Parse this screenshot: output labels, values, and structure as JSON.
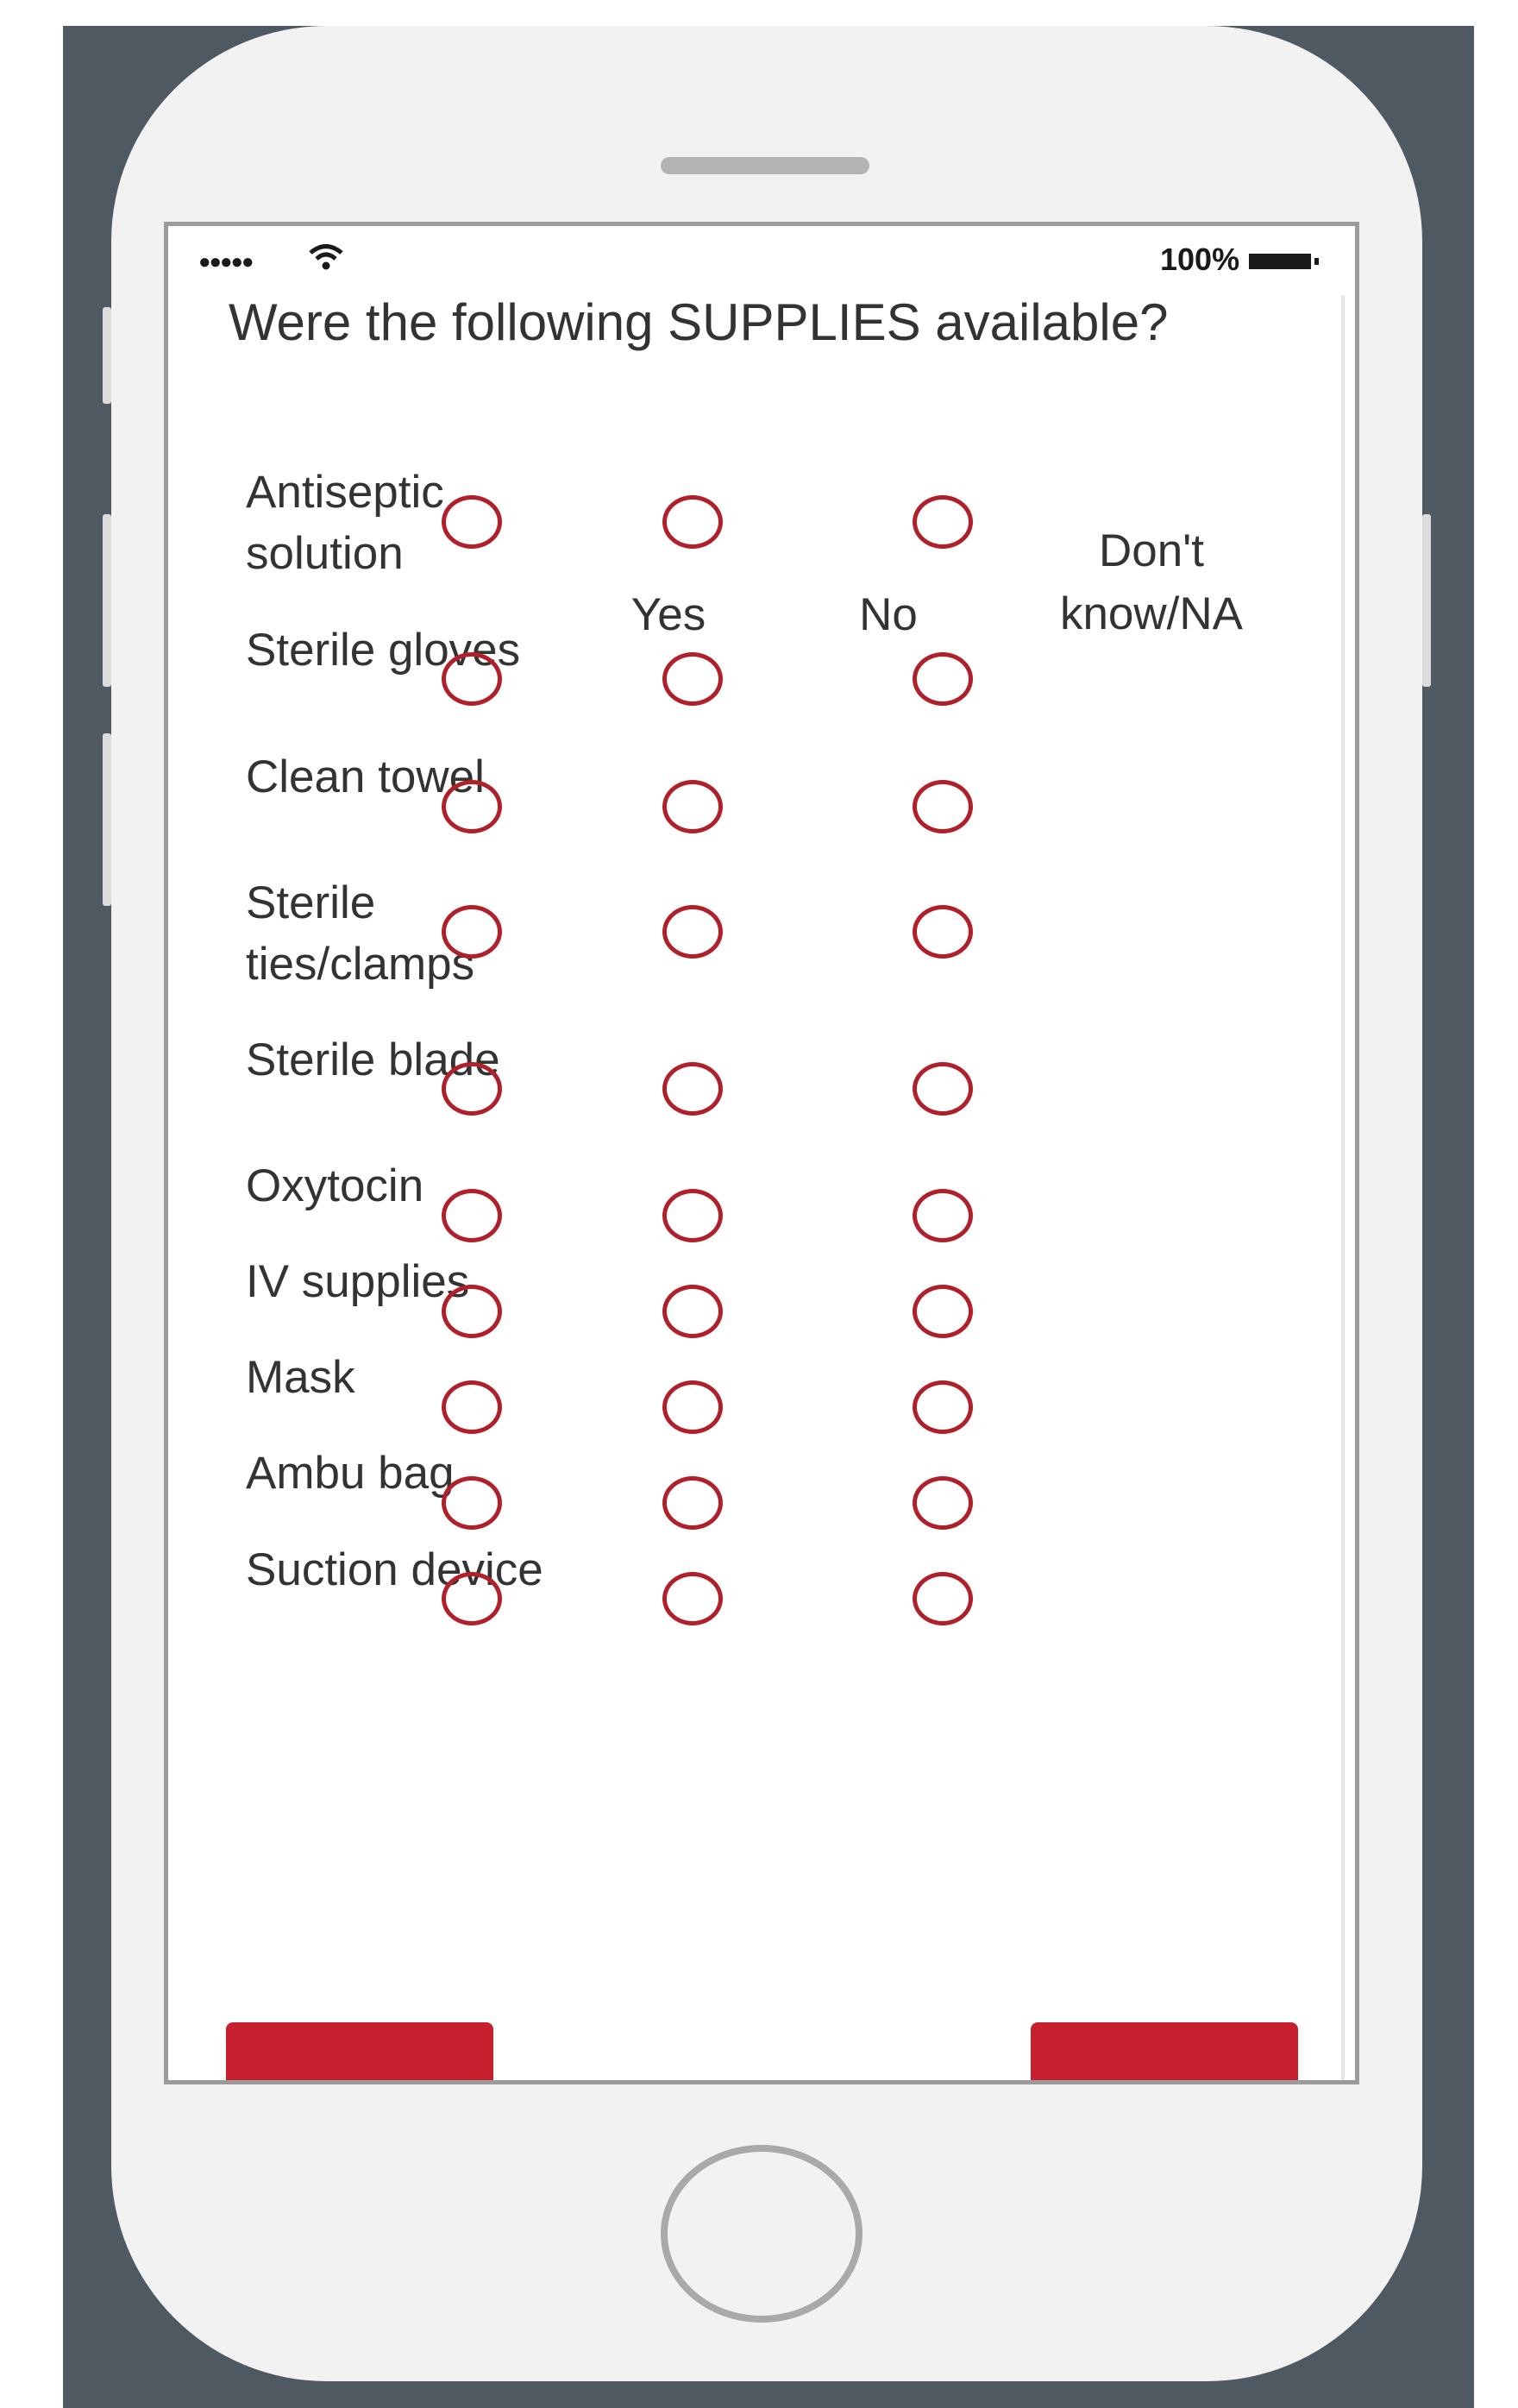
{
  "status": {
    "battery_percent": "100%"
  },
  "question": {
    "title": "Were the following SUPPLIES available?"
  },
  "columns": {
    "yes": "Yes",
    "no": "No",
    "dont_know": "Don't know/NA"
  },
  "items": [
    {
      "label": "Antiseptic solution"
    },
    {
      "label": "Sterile gloves"
    },
    {
      "label": "Clean towel"
    },
    {
      "label": "Sterile ties/clamps"
    },
    {
      "label": "Sterile blade"
    },
    {
      "label": "Oxytocin"
    },
    {
      "label": "IV supplies"
    },
    {
      "label": "Mask"
    },
    {
      "label": "Ambu bag"
    },
    {
      "label": "Suction device"
    }
  ],
  "nav": {
    "back_label": "<<",
    "next_label": ">>"
  },
  "colors": {
    "accent": "#c6202f",
    "radio_stroke": "#b0202a",
    "frame": "#4f5961"
  }
}
